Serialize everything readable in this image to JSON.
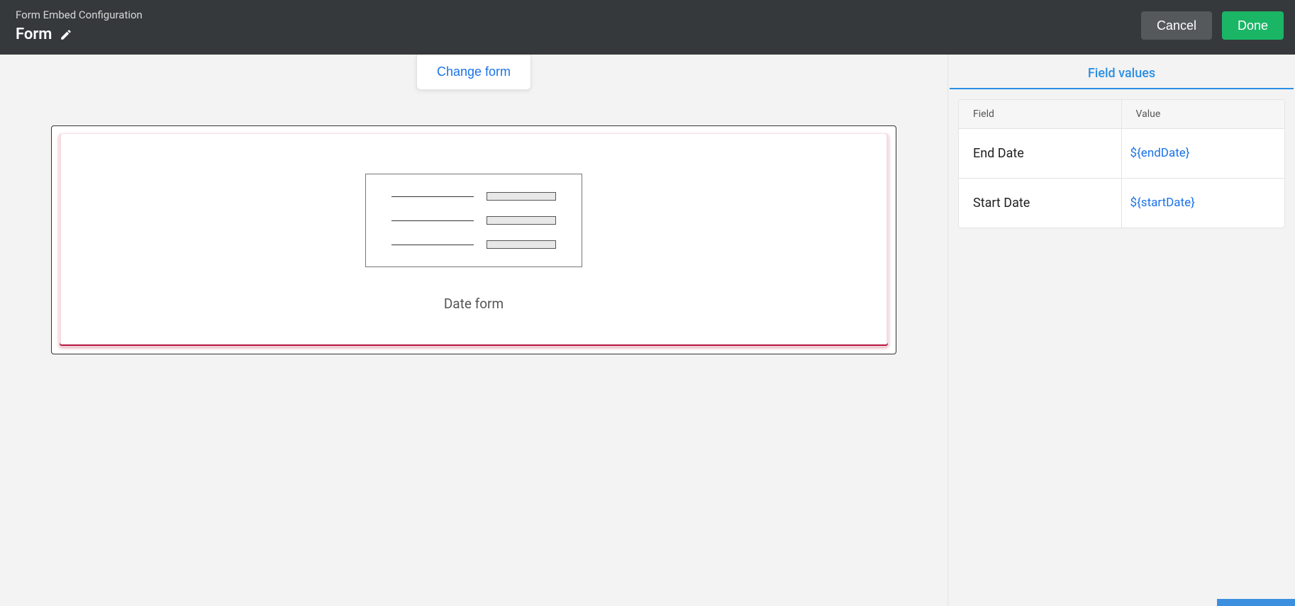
{
  "header": {
    "subtitle": "Form Embed Configuration",
    "title": "Form",
    "cancel_label": "Cancel",
    "done_label": "Done"
  },
  "main": {
    "change_form_label": "Change form",
    "form_name": "Date form"
  },
  "sidebar": {
    "tab_label": "Field values",
    "table": {
      "col_field": "Field",
      "col_value": "Value",
      "rows": [
        {
          "field": "End Date",
          "value": "${endDate}"
        },
        {
          "field": "Start Date",
          "value": "${startDate}"
        }
      ]
    }
  }
}
